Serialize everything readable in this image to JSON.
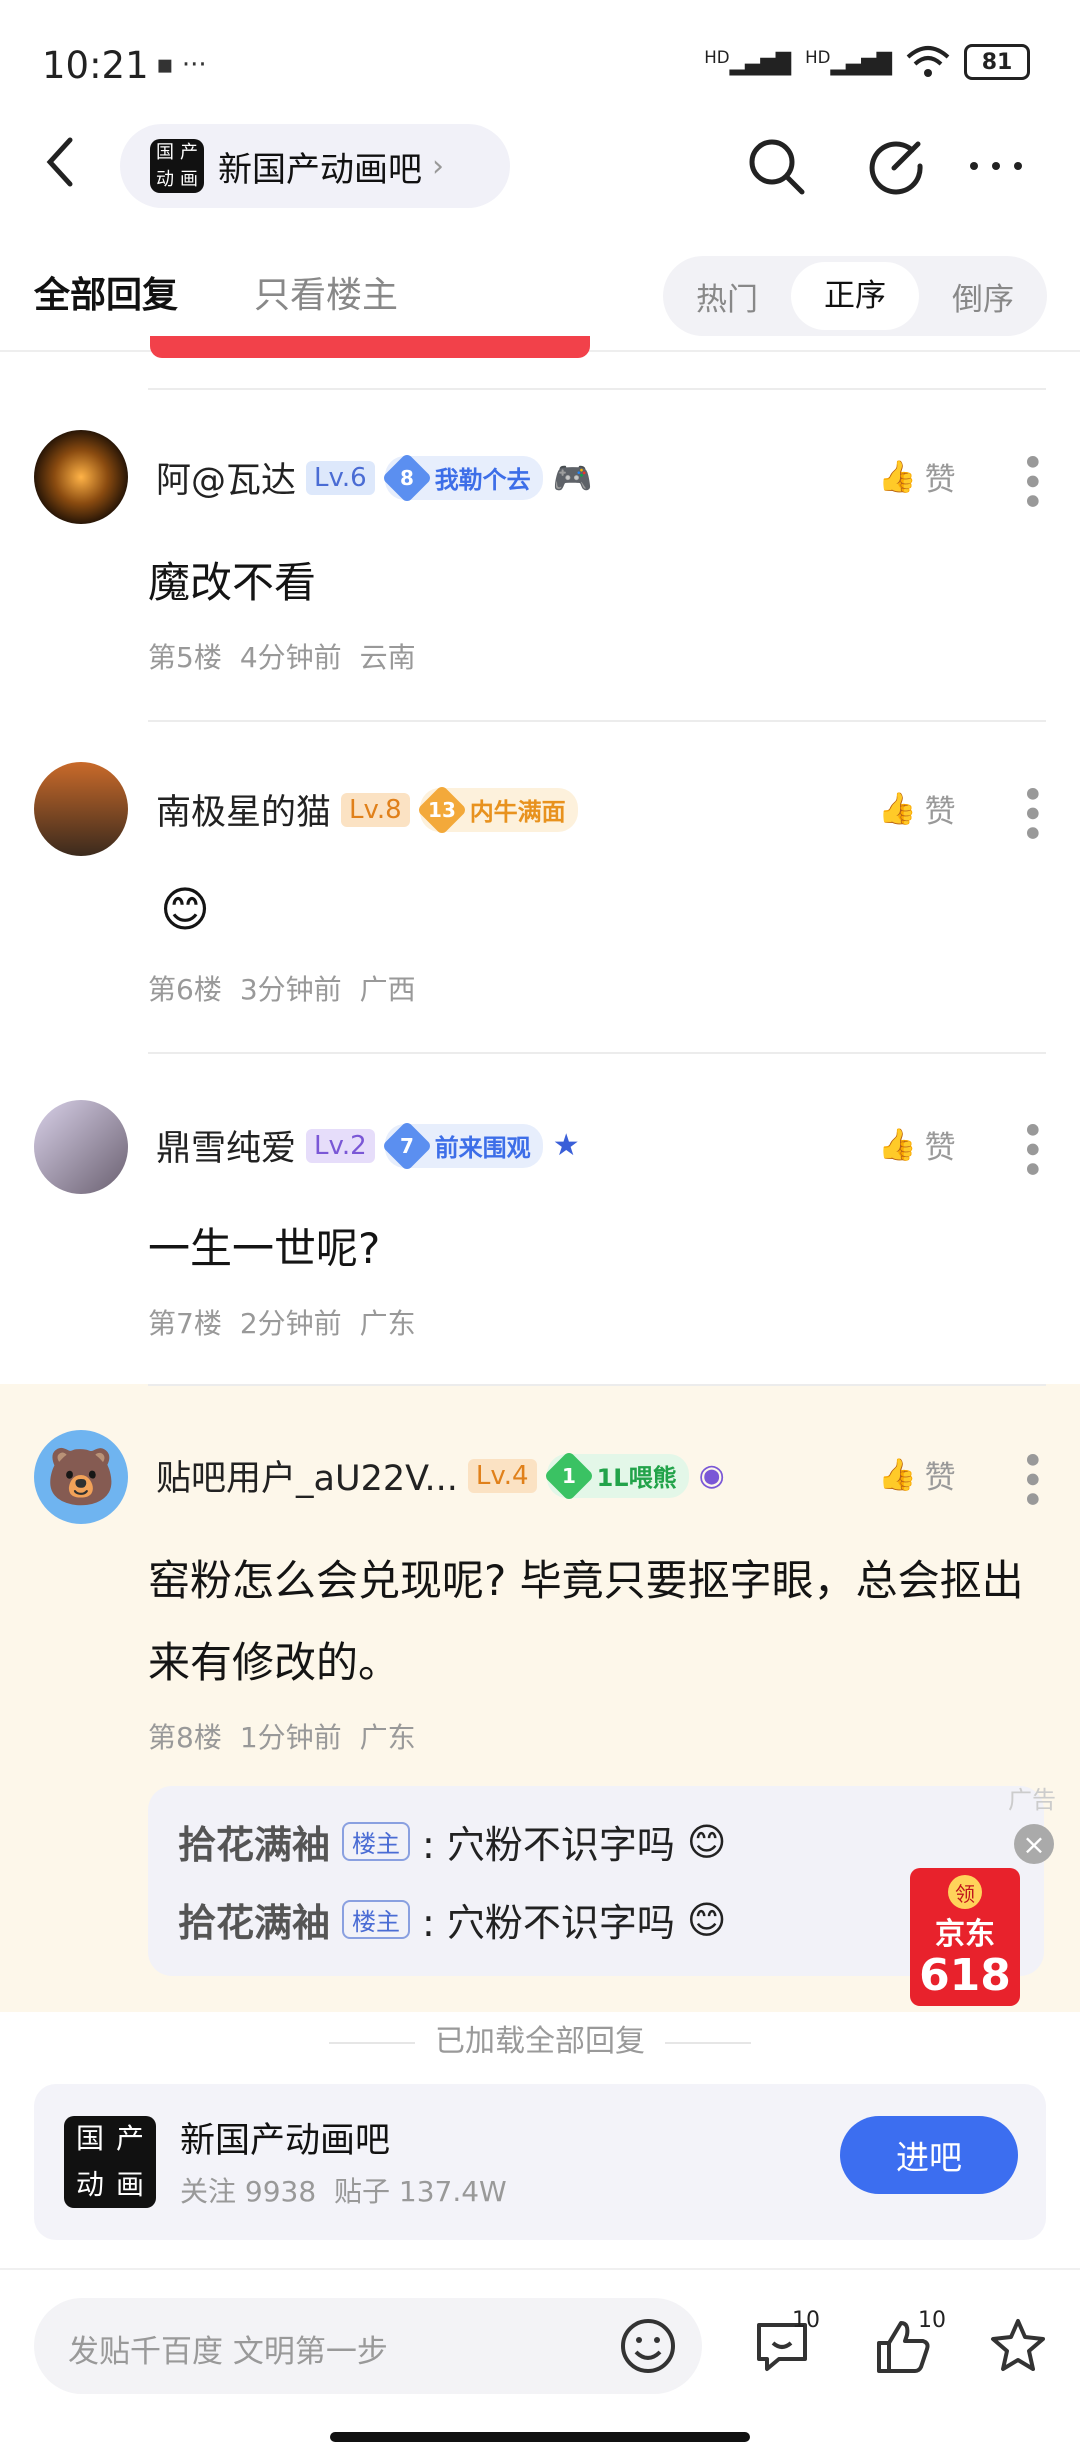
{
  "status": {
    "time": "10:21",
    "battery": "81",
    "hd1": "HD",
    "hd2": "HD"
  },
  "nav": {
    "forum_name": "新国产动画吧",
    "logo_chars": [
      "国",
      "产",
      "动",
      "画"
    ]
  },
  "filter": {
    "tab_all": "全部回复",
    "tab_owner": "只看楼主",
    "sort": [
      "热门",
      "正序",
      "倒序"
    ],
    "sort_active": "正序"
  },
  "like_label": "赞",
  "posts": [
    {
      "user": "阿@瓦达",
      "level": "Lv.6",
      "badge_num": "8",
      "badge_text": "我勒个去",
      "content": "魔改不看",
      "floor": "第5楼",
      "time": "4分钟前",
      "location": "云南"
    },
    {
      "user": "南极星的猫",
      "level": "Lv.8",
      "badge_num": "13",
      "badge_text": "内牛满面",
      "content": "",
      "floor": "第6楼",
      "time": "3分钟前",
      "location": "广西"
    },
    {
      "user": "鼎雪纯爱",
      "level": "Lv.2",
      "badge_num": "7",
      "badge_text": "前来围观",
      "content": "一生一世呢?",
      "floor": "第7楼",
      "time": "2分钟前",
      "location": "广东"
    },
    {
      "user": "贴吧用户_aU22V...",
      "level": "Lv.4",
      "badge_num": "1",
      "badge_text": "1L喂熊",
      "content": "窑粉怎么会兑现呢? 毕竟只要抠字眼，总会抠出来有修改的。",
      "floor": "第8楼",
      "time": "1分钟前",
      "location": "广东"
    }
  ],
  "replies": [
    {
      "name": "拾花满袖",
      "tag": "楼主",
      "text": ": 穴粉不识字吗"
    },
    {
      "name": "拾花满袖",
      "tag": "楼主",
      "text": ": 穴粉不识字吗"
    }
  ],
  "ad": {
    "tag": "广告",
    "close": "×",
    "brand": "京东",
    "number": "618",
    "coupon": "领"
  },
  "loaded_text": "已加载全部回复",
  "forum_card": {
    "name": "新国产动画吧",
    "followers": "关注 9938",
    "posts": "贴子 137.4W",
    "enter": "进吧"
  },
  "bottom": {
    "placeholder": "发贴千百度 文明第一步",
    "comment_count": "10",
    "like_count": "10"
  },
  "colors": {
    "accent": "#3c6ef0",
    "highlight_bg": "#fdf7ea",
    "red": "#f2414a"
  }
}
